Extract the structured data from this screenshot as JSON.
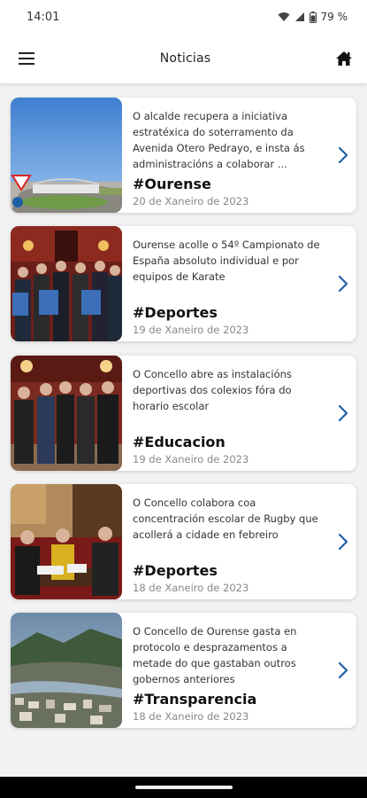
{
  "status_bar": {
    "time": "14:01",
    "battery": "79 %",
    "icons": [
      "wifi-icon",
      "signal-icon",
      "battery-icon"
    ]
  },
  "header": {
    "title": "Noticias",
    "menu_icon": "menu-icon",
    "home_icon": "home-icon"
  },
  "colors": {
    "accent": "#1f5fa8",
    "background": "#f2f2f2",
    "card": "#ffffff"
  },
  "news": [
    {
      "headline": "O alcalde recupera a iniciativa estratéxica do soterramento da Avenida Otero Pedrayo, e insta ás administracións a colaborar ...",
      "tag": "#Ourense",
      "date": "20 de Xaneiro de 2023"
    },
    {
      "headline": "Ourense acolle o 54º Campionato de España absoluto individual e por equipos de Karate",
      "tag": "#Deportes",
      "date": "19 de Xaneiro de 2023"
    },
    {
      "headline": "O Concello abre as instalacións deportivas dos colexios fóra do horario escolar",
      "tag": "#Educacion",
      "date": "19 de Xaneiro de 2023"
    },
    {
      "headline": "O Concello colabora coa concentración escolar  de Rugby que acollerá a cidade en febreiro",
      "tag": "#Deportes",
      "date": "18 de Xaneiro de 2023"
    },
    {
      "headline": "O Concello de Ourense gasta en protocolo e desprazamentos a metade do que gastaban outros gobernos anteriores",
      "tag": "#Transparencia",
      "date": "18 de Xaneiro de 2023"
    }
  ]
}
